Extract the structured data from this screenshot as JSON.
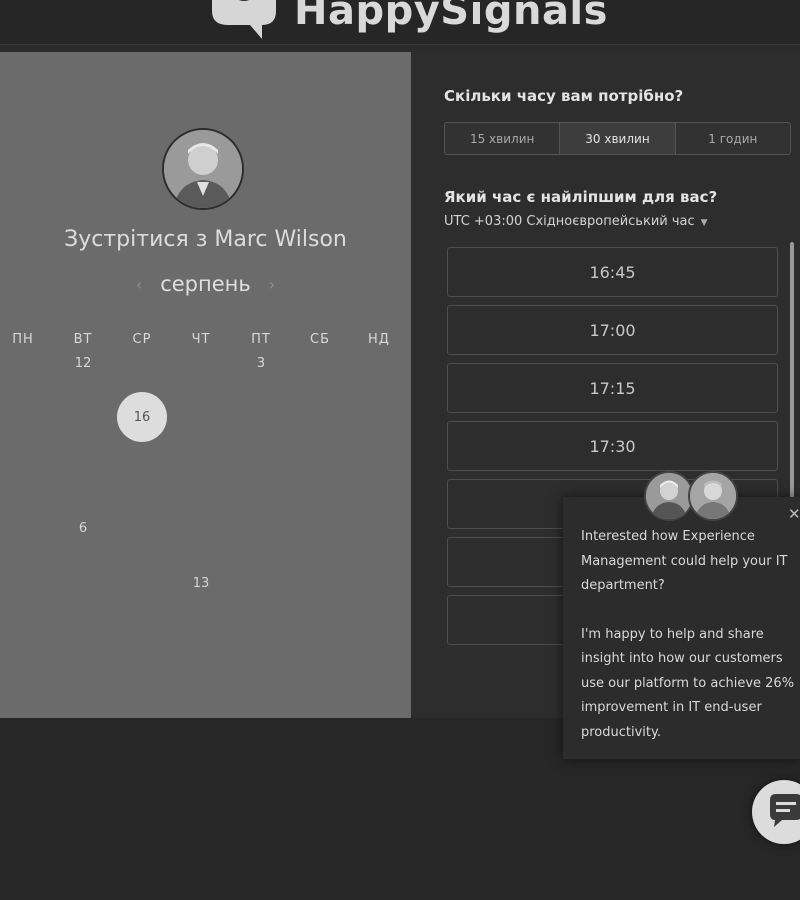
{
  "header": {
    "logo_text": "HappySignals"
  },
  "calendar": {
    "title": "Зустрітися з Marc Wilson",
    "month": "серпень",
    "prev_icon": "chevron-left-icon",
    "next_icon": "chevron-right-icon",
    "weekdays": [
      "ПН",
      "ВТ",
      "СР",
      "ЧТ",
      "ПТ",
      "СБ",
      "НД"
    ],
    "weeks": [
      [
        "",
        "12",
        "",
        "",
        "3",
        "",
        ""
      ],
      [
        "",
        "",
        "16",
        "",
        "",
        "",
        ""
      ],
      [
        "",
        "",
        "",
        "",
        "",
        "",
        ""
      ],
      [
        "",
        "6",
        "",
        "",
        "",
        "",
        ""
      ],
      [
        "",
        "",
        "",
        "13",
        "",
        "",
        ""
      ],
      [
        "",
        "",
        "",
        "",
        "",
        "",
        ""
      ]
    ],
    "selected_day": "16"
  },
  "duration": {
    "question": "Скільки часу вам потрібно?",
    "options": [
      "15 хвилин",
      "30 хвилин",
      "1 годин"
    ],
    "selected": "30 хвилин"
  },
  "time": {
    "question": "Який час є найліпшим для вас?",
    "timezone": "UTC +03:00 Східноєвропейський час",
    "slots": [
      "16:45",
      "17:00",
      "17:15",
      "17:30",
      "",
      "",
      ""
    ]
  },
  "chat_popup": {
    "paragraph1": "Interested how Experience Management could help your IT department?",
    "paragraph2": "I'm happy to help and share insight into how our customers use our platform to achieve 26% improvement in IT end-user productivity.",
    "close_label": "✕"
  },
  "colors": {
    "left_panel": "#6b6b6b",
    "right_panel": "#2d2d2d",
    "selected_day_bg": "#dddddd"
  }
}
